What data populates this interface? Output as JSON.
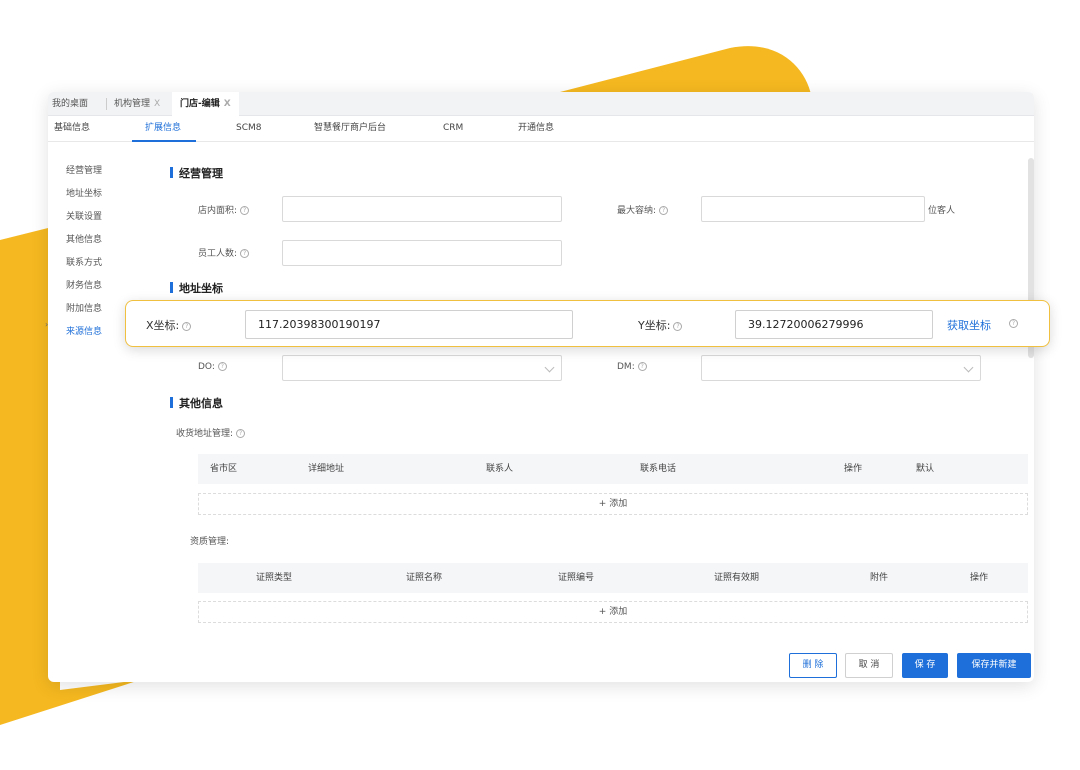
{
  "colors": {
    "accent": "#1e6fd9",
    "brand_yellow": "#f5b820",
    "highlight_border": "#f0c040"
  },
  "tabs": [
    {
      "label": "我的桌面",
      "closable": false
    },
    {
      "label": "机构管理",
      "close": "X"
    },
    {
      "label": "门店-编辑",
      "close": "X",
      "active": true
    }
  ],
  "subtabs": [
    "基础信息",
    "扩展信息",
    "SCM8",
    "智慧餐厅商户后台",
    "CRM",
    "开通信息"
  ],
  "active_subtab": "扩展信息",
  "leftnav": [
    "经营管理",
    "地址坐标",
    "关联设置",
    "其他信息",
    "联系方式",
    "财务信息",
    "附加信息",
    "来源信息"
  ],
  "active_leftnav": "来源信息",
  "sections": {
    "business": {
      "title": "经营管理",
      "area_label": "店内面积:",
      "capacity_label": "最大容纳:",
      "capacity_unit": "位客人",
      "staff_label": "员工人数:"
    },
    "address": {
      "title": "地址坐标"
    },
    "do_label": "DO:",
    "dm_label": "DM:",
    "other": {
      "title": "其他信息",
      "shipping_label": "收货地址管理:",
      "shipping_columns": [
        "省市区",
        "详细地址",
        "联系人",
        "联系电话",
        "操作",
        "默认"
      ],
      "add_label": "+ 添加",
      "qualification_label": "资质管理:",
      "qualification_columns": [
        "证照类型",
        "证照名称",
        "证照编号",
        "证照有效期",
        "附件",
        "操作"
      ]
    }
  },
  "coords": {
    "x_label": "X坐标:",
    "x_value": "117.20398300190197",
    "y_label": "Y坐标:",
    "y_value": "39.12720006279996",
    "get_label": "获取坐标"
  },
  "help_glyph": "?",
  "footer": {
    "delete": "删 除",
    "cancel": "取 消",
    "save": "保 存",
    "save_new": "保存并新建"
  }
}
